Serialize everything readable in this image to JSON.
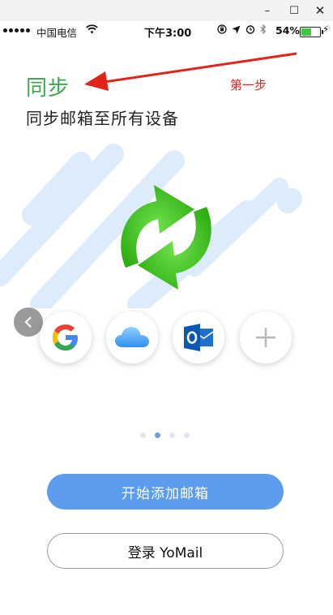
{
  "window": {
    "minimize_glyph": "–",
    "maximize_glyph": "☐",
    "close_glyph": "✕"
  },
  "status_bar": {
    "carrier": "中国电信",
    "time": "下午3:00",
    "battery_percent": "54%",
    "battery_level": 0.54
  },
  "onboarding": {
    "title": "同步",
    "subtitle": "同步邮箱至所有设备",
    "annotation": "第一步",
    "page_count": 4,
    "current_page": 2
  },
  "providers": [
    {
      "name": "google",
      "icon": "google-logo-icon"
    },
    {
      "name": "icloud",
      "icon": "icloud-icon"
    },
    {
      "name": "outlook",
      "icon": "outlook-icon"
    },
    {
      "name": "add",
      "icon": "plus-icon"
    }
  ],
  "actions": {
    "start_add_mailbox": "开始添加邮箱",
    "login": "登录 YoMail"
  },
  "colors": {
    "title_green": "#3aa64a",
    "primary_blue": "#5b9cec",
    "annotation_red": "#e2231a",
    "sync_green": "#3fbf1f"
  }
}
